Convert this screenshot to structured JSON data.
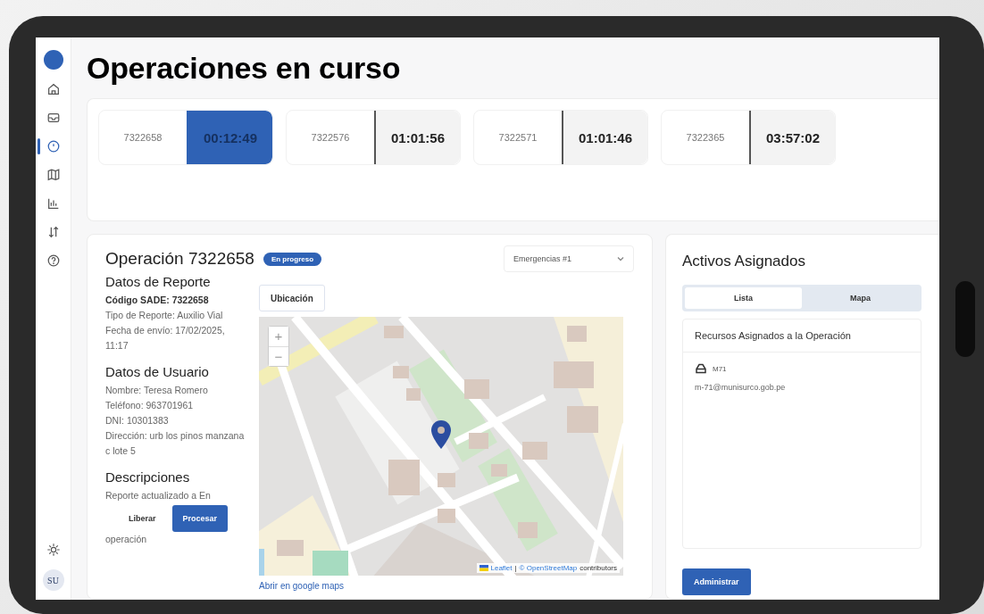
{
  "page": {
    "title": "Operaciones en curso"
  },
  "sidebar": {
    "items": [
      {
        "kind": "home",
        "selected": false
      },
      {
        "kind": "inbox",
        "selected": false
      },
      {
        "kind": "clock",
        "selected": true
      },
      {
        "kind": "map",
        "selected": false
      },
      {
        "kind": "chart",
        "selected": false
      },
      {
        "kind": "sort",
        "selected": false
      },
      {
        "kind": "help",
        "selected": false
      }
    ],
    "avatar": "SU"
  },
  "operations": [
    {
      "code": "7322658",
      "timer": "00:12:49",
      "selected": true
    },
    {
      "code": "7322576",
      "timer": "01:01:56",
      "selected": false
    },
    {
      "code": "7322571",
      "timer": "01:01:46",
      "selected": false
    },
    {
      "code": "7322365",
      "timer": "03:57:02",
      "selected": false
    }
  ],
  "operation": {
    "title": "Operación 7322658",
    "status": "En progreso",
    "dropdown": "Emergencias #1",
    "sections": [
      {
        "heading": "Datos de Reporte",
        "lines": [
          {
            "text": "Código SADE: 7322658",
            "kind": "strong"
          },
          {
            "text": "Tipo de Reporte: Auxilio Vial",
            "kind": "plain"
          },
          {
            "text": "Fecha de envío: 17/02/2025, 11:17",
            "kind": "plain"
          }
        ]
      },
      {
        "heading": "Datos de Usuario",
        "lines": [
          {
            "text": "Nombre: Teresa Romero",
            "kind": "plain"
          },
          {
            "text": "Teléfono: 963701961",
            "kind": "plain"
          },
          {
            "text": "DNI: 10301383",
            "kind": "plain"
          },
          {
            "text": "Dirección: urb los pinos manzana c lote 5",
            "kind": "plain"
          }
        ]
      },
      {
        "heading": "Descripciones"
      }
    ],
    "description_top": "Reporte actualizado a En",
    "description_bottom": "operación",
    "buttons": [
      {
        "label": "Liberar",
        "kind": "secondary"
      },
      {
        "label": "Procesar",
        "kind": "primary"
      }
    ],
    "location_tab": "Ubicación",
    "map": {
      "zoom_in": "+",
      "zoom_out": "−",
      "attribution": [
        "Leaflet",
        "|",
        "© OpenStreetMap",
        "contributors"
      ]
    },
    "maps_link": "Abrir en google maps"
  },
  "assets": {
    "title": "Activos Asignados",
    "tabs": [
      {
        "label": "Lista",
        "selected": true
      },
      {
        "label": "Mapa",
        "selected": false
      }
    ],
    "list_title": "Recursos Asignados a la Operación",
    "resources": [
      {
        "name": "M71",
        "email": "m-71@munisurco.gob.pe"
      }
    ],
    "button": "Administrar"
  }
}
